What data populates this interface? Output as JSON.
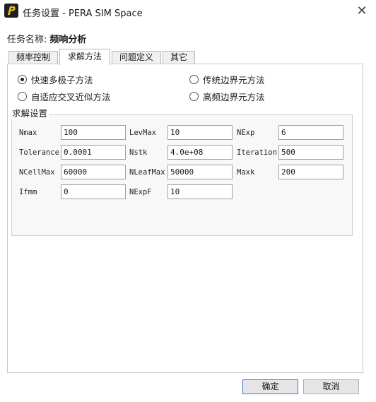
{
  "window": {
    "title": "任务设置 - PERA SIM Space",
    "close_glyph": "✕"
  },
  "task": {
    "name_label": "任务名称:",
    "name_value": "频响分析"
  },
  "tabs": [
    {
      "label": "频率控制"
    },
    {
      "label": "求解方法",
      "active": true
    },
    {
      "label": "问题定义"
    },
    {
      "label": "其它"
    }
  ],
  "methods": [
    {
      "label": "快速多极子方法",
      "selected": true
    },
    {
      "label": "传统边界元方法",
      "selected": false
    },
    {
      "label": "自适应交叉近似方法",
      "selected": false
    },
    {
      "label": "高频边界元方法",
      "selected": false
    }
  ],
  "solver_settings": {
    "title": "求解设置",
    "fields": {
      "nmax": {
        "label": "Nmax",
        "value": "100"
      },
      "levmax": {
        "label": "LevMax",
        "value": "10"
      },
      "nexp": {
        "label": "NExp",
        "value": "6"
      },
      "tolerance": {
        "label": "Tolerance",
        "value": "0.0001"
      },
      "nstk": {
        "label": "Nstk",
        "value": "4.0e+08"
      },
      "iteration": {
        "label": "Iteration",
        "value": "500"
      },
      "ncellmax": {
        "label": "NCellMax",
        "value": "60000"
      },
      "nleafmax": {
        "label": "NLeafMax",
        "value": "50000"
      },
      "maxk": {
        "label": "Maxk",
        "value": "200"
      },
      "ifmm": {
        "label": "Ifmm",
        "value": "0"
      },
      "nexpf": {
        "label": "NExpF",
        "value": "10"
      }
    }
  },
  "footer": {
    "ok_label": "确定",
    "cancel_label": "取消"
  }
}
